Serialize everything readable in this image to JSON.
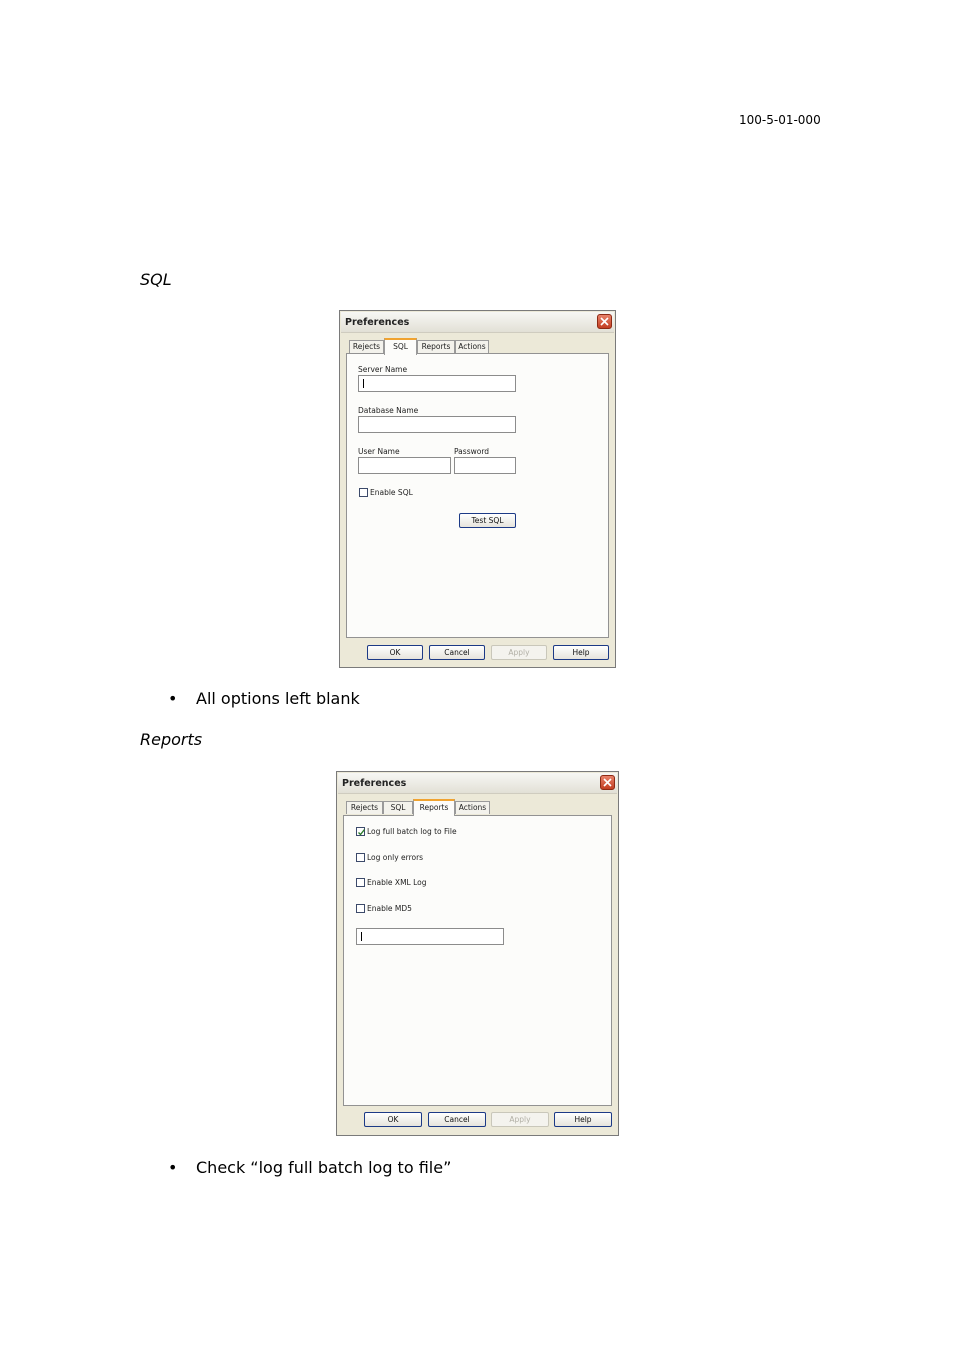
{
  "doc_id": "100-5-01-000",
  "sections": [
    {
      "heading": "SQL",
      "bullet": "All options left blank"
    },
    {
      "heading": "Reports",
      "bullet": "Check “log full batch log to file”"
    }
  ],
  "dialog1": {
    "title": "Preferences",
    "tabs": [
      "Rejects",
      "SQL",
      "Reports",
      "Actions"
    ],
    "active_tab": "SQL",
    "fields": {
      "server_name_label": "Server Name",
      "server_name_value": "",
      "database_name_label": "Database Name",
      "database_name_value": "",
      "user_name_label": "User Name",
      "user_name_value": "",
      "password_label": "Password",
      "password_value": ""
    },
    "enable_sql": {
      "label": "Enable SQL",
      "checked": false
    },
    "test_button": "Test SQL",
    "buttons": {
      "ok": "OK",
      "cancel": "Cancel",
      "apply": "Apply",
      "help": "Help"
    }
  },
  "dialog2": {
    "title": "Preferences",
    "tabs": [
      "Rejects",
      "SQL",
      "Reports",
      "Actions"
    ],
    "active_tab": "Reports",
    "checkboxes": [
      {
        "label": "Log full batch log to File",
        "checked": true
      },
      {
        "label": "Log only errors",
        "checked": false
      },
      {
        "label": "Enable XML Log",
        "checked": false
      },
      {
        "label": "Enable MD5",
        "checked": false
      }
    ],
    "text_value": "",
    "buttons": {
      "ok": "OK",
      "cancel": "Cancel",
      "apply": "Apply",
      "help": "Help"
    }
  },
  "colors": {
    "active_tab_accent": "#f0a330",
    "close_button": "#c33e22",
    "button_border": "#1c3a86"
  }
}
